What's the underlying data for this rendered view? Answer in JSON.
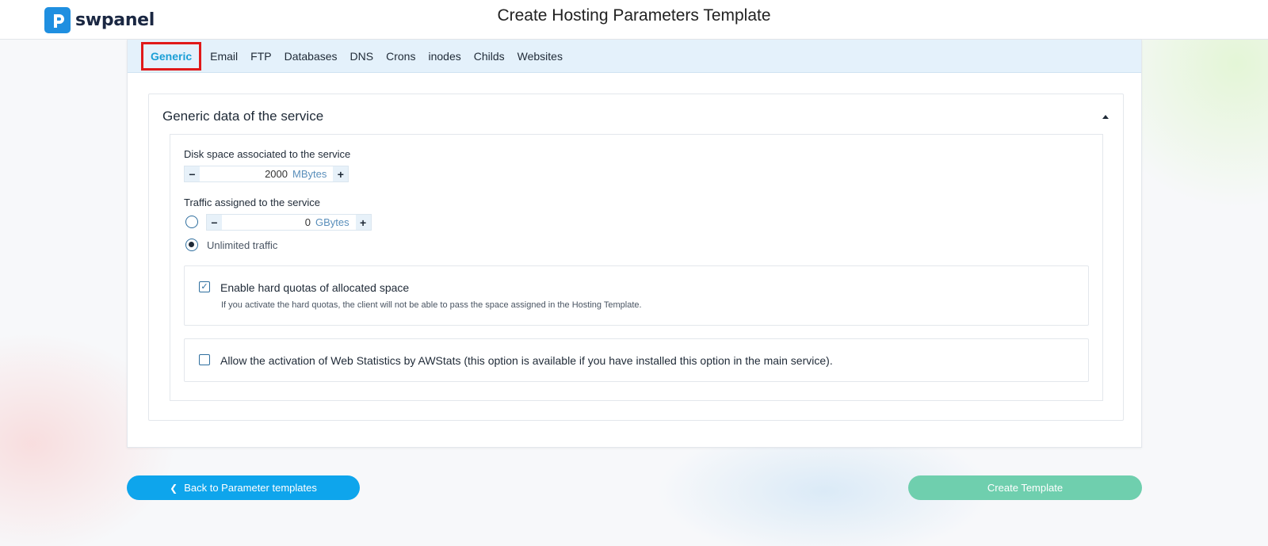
{
  "header": {
    "logo_text": "swpanel",
    "page_title": "Create Hosting Parameters Template"
  },
  "tabs": [
    {
      "label": "Generic",
      "active": true
    },
    {
      "label": "Email",
      "active": false
    },
    {
      "label": "FTP",
      "active": false
    },
    {
      "label": "Databases",
      "active": false
    },
    {
      "label": "DNS",
      "active": false
    },
    {
      "label": "Crons",
      "active": false
    },
    {
      "label": "inodes",
      "active": false
    },
    {
      "label": "Childs",
      "active": false
    },
    {
      "label": "Websites",
      "active": false
    }
  ],
  "section": {
    "title": "Generic data of the service",
    "expanded": true,
    "disk": {
      "label": "Disk space associated to the service",
      "value": "2000",
      "unit": "MBytes"
    },
    "traffic": {
      "label": "Traffic assigned to the service",
      "value": "0",
      "unit": "GBytes",
      "unlimited_label": "Unlimited traffic",
      "selected": "unlimited"
    },
    "hard_quotas": {
      "checked": true,
      "title": "Enable hard quotas of allocated space",
      "help": "If you activate the hard quotas, the client will not be able to pass the space assigned in the Hosting Template."
    },
    "awstats": {
      "checked": false,
      "title": "Allow the activation of Web Statistics by AWStats (this option is available if you have installed this option in the main service)."
    }
  },
  "footer": {
    "back_label": "Back to Parameter templates",
    "create_label": "Create Template"
  },
  "colors": {
    "accent": "#0ea5ec",
    "create_button": "#6fcfae",
    "active_tab": "#1a9fd6",
    "highlight_box": "#e01919"
  }
}
